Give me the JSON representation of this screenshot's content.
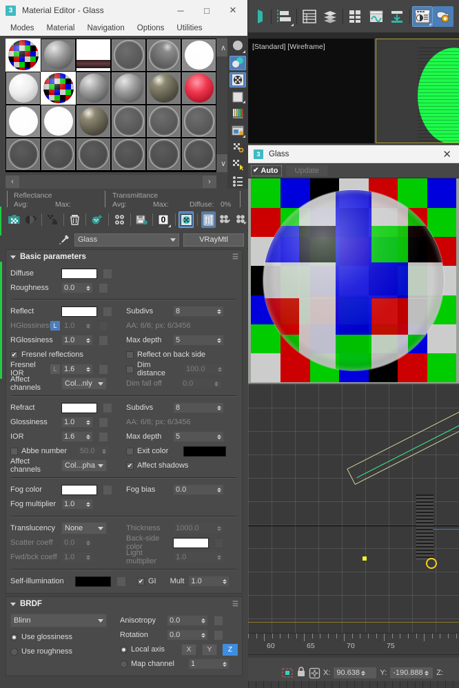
{
  "material_editor": {
    "window_title": "Material Editor - Glass",
    "app_badge": "3",
    "window_buttons": {
      "minimize": "─",
      "maximize": "□",
      "close": "✕"
    },
    "menu": [
      "Modes",
      "Material",
      "Navigation",
      "Options",
      "Utilities"
    ],
    "slot_scroll": {
      "up": "∧",
      "down": "∨",
      "left": "‹",
      "right": "›"
    },
    "slots": [
      {
        "index": 0,
        "type": "checker-map",
        "selected": true
      },
      {
        "index": 1,
        "type": "grey-glossy",
        "selected": false
      },
      {
        "index": 2,
        "type": "dark-plane",
        "selected": false
      },
      {
        "index": 3,
        "type": "grey-matte",
        "selected": false
      },
      {
        "index": 4,
        "type": "grey-spec",
        "selected": false
      },
      {
        "index": 5,
        "type": "white-bright",
        "selected": false
      },
      {
        "index": 6,
        "type": "white-soft",
        "selected": false
      },
      {
        "index": 7,
        "type": "checker-map",
        "selected": true
      },
      {
        "index": 8,
        "type": "grey-glossy",
        "selected": false
      },
      {
        "index": 9,
        "type": "grey-glossy",
        "selected": false
      },
      {
        "index": 10,
        "type": "olive-gloss",
        "selected": false
      },
      {
        "index": 11,
        "type": "red-gloss",
        "selected": false
      },
      {
        "index": 12,
        "type": "white-flat",
        "selected": false
      },
      {
        "index": 13,
        "type": "white-flat",
        "selected": false
      },
      {
        "index": 14,
        "type": "olive-gloss",
        "selected": false
      },
      {
        "index": 15,
        "type": "grey-matte",
        "selected": false
      },
      {
        "index": 16,
        "type": "grey-matte",
        "selected": false
      },
      {
        "index": 17,
        "type": "grey-matte",
        "selected": false
      },
      {
        "index": 18,
        "type": "grey-dark",
        "selected": false
      },
      {
        "index": 19,
        "type": "grey-dark",
        "selected": false
      },
      {
        "index": 20,
        "type": "grey-dark",
        "selected": false
      },
      {
        "index": 21,
        "type": "grey-dark",
        "selected": false
      },
      {
        "index": 22,
        "type": "grey-dark",
        "selected": false
      },
      {
        "index": 23,
        "type": "grey-dark",
        "selected": false
      }
    ],
    "stats": {
      "reflectance_label": "Reflectance",
      "transmittance_label": "Transmittance",
      "avg_label": "Avg:",
      "max_label": "Max:",
      "avg_label2": "Avg:",
      "max_label2": "Max:",
      "diffuse_label": "Diffuse:",
      "diffuse_value": "0%"
    },
    "toolbar_icons": [
      "get-material-icon",
      "put-material-to-scene-icon",
      "assign-material-icon",
      "reset-map-icon",
      "make-material-copy-icon",
      "make-unique-icon",
      "put-to-library-icon",
      "material-effects-channel-icon",
      "show-in-viewport-icon",
      "show-end-result-icon",
      "go-to-parent-icon",
      "go-forward-to-sibling-icon"
    ],
    "name_row": {
      "eyedropper_icon": "pick-material-icon",
      "material_name": "Glass",
      "material_type": "VRayMtl"
    }
  },
  "basic_parameters": {
    "title": "Basic parameters",
    "diffuse": {
      "label": "Diffuse",
      "color": "#ffffff"
    },
    "roughness": {
      "label": "Roughness",
      "value": "0.0"
    },
    "reflect": {
      "label": "Reflect",
      "color": "#ffffff"
    },
    "hglossiness": {
      "label": "HGlossiness",
      "value": "1.0",
      "lock_badge": "L",
      "disabled": true
    },
    "rglossiness": {
      "label": "RGlossiness",
      "value": "1.0"
    },
    "reflect_subdivs": {
      "label": "Subdivs",
      "value": "8"
    },
    "reflect_aa": "AA: 6/6; px: 6/3456",
    "reflect_max_depth": {
      "label": "Max depth",
      "value": "5"
    },
    "fresnel_reflections": {
      "label": "Fresnel reflections",
      "checked": true
    },
    "fresnel_ior": {
      "label": "Fresnel IOR",
      "value": "1.6",
      "lock_badge": "L"
    },
    "reflect_affect_channels": {
      "label": "Affect channels",
      "value": "Col...nly"
    },
    "reflect_on_back_side": {
      "label": "Reflect on back side",
      "checked": false
    },
    "dim_distance": {
      "label": "Dim distance",
      "value": "100.0",
      "checked": false
    },
    "dim_fall_off": {
      "label": "Dim fall off",
      "value": "0.0",
      "disabled": true
    },
    "refract": {
      "label": "Refract",
      "color": "#ffffff"
    },
    "refract_glossiness": {
      "label": "Glossiness",
      "value": "1.0"
    },
    "ior": {
      "label": "IOR",
      "value": "1.6"
    },
    "refract_subdivs": {
      "label": "Subdivs",
      "value": "8"
    },
    "refract_aa": "AA: 6/6; px: 6/3456",
    "refract_max_depth": {
      "label": "Max depth",
      "value": "5"
    },
    "abbe_number": {
      "label": "Abbe number",
      "value": "50.0",
      "checked": false
    },
    "exit_color": {
      "label": "Exit color",
      "checked": false,
      "color": "#000000"
    },
    "refract_affect_channels": {
      "label": "Affect channels",
      "value": "Col...pha"
    },
    "affect_shadows": {
      "label": "Affect shadows",
      "checked": true
    },
    "fog_color": {
      "label": "Fog color",
      "color": "#ffffff"
    },
    "fog_multiplier": {
      "label": "Fog multiplier",
      "value": "1.0"
    },
    "fog_bias": {
      "label": "Fog bias",
      "value": "0.0"
    },
    "translucency": {
      "label": "Translucency",
      "value": "None"
    },
    "thickness": {
      "label": "Thickness",
      "value": "1000.0",
      "disabled": true
    },
    "scatter_coeff": {
      "label": "Scatter coeff",
      "value": "0.0",
      "disabled": true
    },
    "back_side_color": {
      "label": "Back-side color",
      "color": "#ffffff",
      "disabled": true
    },
    "fwd_bck_coeff": {
      "label": "Fwd/bck coeff",
      "value": "1.0",
      "disabled": true
    },
    "light_multiplier": {
      "label": "Light multiplier",
      "value": "1.0",
      "disabled": true
    },
    "self_illumination": {
      "label": "Self-illumination",
      "color": "#000000"
    },
    "gi": {
      "label": "GI",
      "checked": true
    },
    "mult": {
      "label": "Mult",
      "value": "1.0"
    }
  },
  "brdf": {
    "title": "BRDF",
    "model": "Blinn",
    "use_glossiness": {
      "label": "Use glossiness",
      "selected": true
    },
    "use_roughness": {
      "label": "Use roughness",
      "selected": false
    },
    "anisotropy": {
      "label": "Anisotropy",
      "value": "0.0"
    },
    "rotation": {
      "label": "Rotation",
      "value": "0.0"
    },
    "local_axis": {
      "label": "Local axis",
      "selected": true,
      "axes": [
        "X",
        "Y",
        "Z"
      ],
      "active_axis": "Z"
    },
    "map_channel": {
      "label": "Map channel",
      "value": "1",
      "selected": false
    }
  },
  "max_toolbar": {
    "icons": [
      "select-object-icon",
      "align-icon",
      "layer-manager-icon",
      "layer-explorer-icon",
      "compact-material-editor-icon",
      "curve-editor-icon",
      "schematic-view-icon",
      "render-setup-icon",
      "rendered-frame-window-icon",
      "render-production-icon"
    ],
    "active": [
      "render-setup-icon",
      "rendered-frame-window-icon"
    ]
  },
  "viewport": {
    "label": "[Standard] [Wireframe]"
  },
  "frame_buffer": {
    "app_badge": "3",
    "title": "Glass",
    "close": "✕",
    "auto_label": "Auto",
    "auto_checked": true,
    "auto_check_glyph": "✔",
    "update_label": "Update",
    "update_disabled": true,
    "render_content": {
      "type": "glass-sphere-over-rgb-checker",
      "checker_colors": [
        "#00cc00",
        "#0000dd",
        "#000000",
        "#cccccc",
        "#cc0000"
      ],
      "checker_cols": 7,
      "checker_rows": 7
    }
  },
  "timeline": {
    "ticks": [
      "60",
      "65",
      "70",
      "75"
    ]
  },
  "statusbar": {
    "select_icon": "selection-lock-icon",
    "lock_icon": "lock-icon",
    "transform_icon": "absolute-mode-transform-icon",
    "x_label": "X:",
    "x_value": "90.638",
    "y_label": "Y:",
    "y_value": "-190.888",
    "z_label": "Z:"
  },
  "colors": {
    "accent_blue": "#4c7fba",
    "axis_active": "#3f8de0",
    "panel_bg": "#444444",
    "teal_badge": "#3fbac2"
  }
}
